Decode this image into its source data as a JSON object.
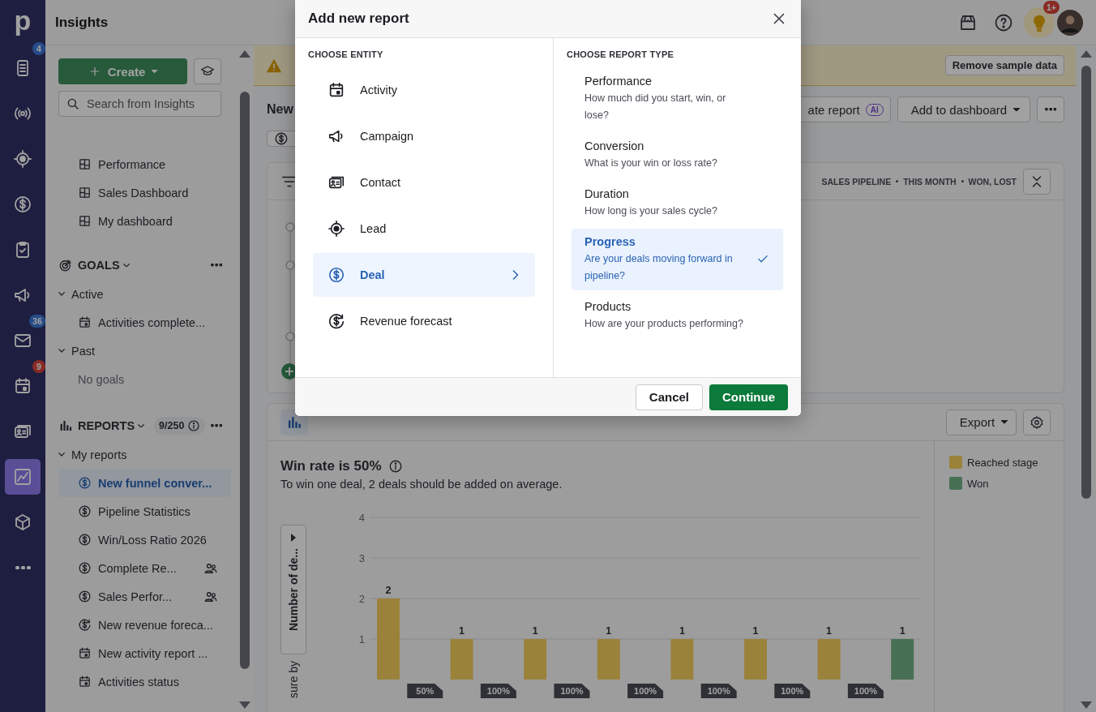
{
  "rail": {
    "logo": "p",
    "items": [
      {
        "selected": false,
        "badge": "4",
        "color": "#254c88"
      },
      {
        "selected": false
      },
      {
        "selected": false
      },
      {
        "selected": false
      },
      {
        "selected": false
      },
      {
        "selected": false
      },
      {
        "selected": false,
        "badge": "36",
        "color": "#254c88"
      },
      {
        "selected": false,
        "badge": "9",
        "color": "#882b25"
      },
      {
        "selected": false
      },
      {
        "selected": true
      },
      {
        "selected": false
      },
      {
        "selected": false
      }
    ]
  },
  "topbar": {
    "title": "Insights",
    "tips_badge": "1+"
  },
  "sidebar": {
    "create_button": "Create",
    "search": {
      "placeholder": "Search from Insights"
    },
    "dashboards": [
      {
        "label": "Performance"
      },
      {
        "label": "Sales Dashboard"
      },
      {
        "label": "My dashboard"
      }
    ],
    "goals": {
      "title": "GOALS",
      "expanded": true,
      "groups": [
        {
          "label": "Active",
          "expanded": true,
          "children": [
            {
              "label": "Activities complete...",
              "kind": "activity"
            }
          ]
        },
        {
          "label": "Past",
          "expanded": true,
          "empty_text": "No goals"
        }
      ]
    },
    "reports": {
      "title": "REPORTS",
      "expanded": true,
      "count": "9/250",
      "groups": [
        {
          "label": "My reports",
          "expanded": true,
          "children": [
            {
              "label": "New funnel conver...",
              "kind": "deal",
              "shared": false,
              "selected": true
            },
            {
              "label": "Pipeline Statistics",
              "kind": "deal",
              "shared": false,
              "selected": false
            },
            {
              "label": "Win/Loss Ratio 2026",
              "kind": "deal",
              "shared": false,
              "selected": false
            },
            {
              "label": "Complete Re...",
              "kind": "deal",
              "shared": true,
              "selected": false
            },
            {
              "label": "Sales Perfor...",
              "kind": "deal",
              "shared": true,
              "selected": false
            },
            {
              "label": "New revenue foreca...",
              "kind": "forecast",
              "shared": false,
              "selected": false
            },
            {
              "label": "New activity report ...",
              "kind": "activity",
              "shared": false,
              "selected": false
            },
            {
              "label": "Activities status",
              "kind": "activity",
              "shared": false,
              "selected": false
            }
          ]
        }
      ]
    }
  },
  "banner": {
    "button": "Remove sample data"
  },
  "report_header": {
    "title": "New",
    "ai_button": {
      "label": "ate report",
      "badge": "AI"
    },
    "dashboard_button": "Add to dashboard"
  },
  "filters_card": {
    "summary": [
      "SALES PIPELINE",
      "THIS MONTH",
      "WON, LOST"
    ]
  },
  "chart_card": {
    "export_button": "Export",
    "title": "Win rate is 50%",
    "subtitle": "To win one deal, 2 deals should be added on average.",
    "axis_selector": "Number of de...",
    "axis_caption": "sure by",
    "chart_data": {
      "type": "bar",
      "stacked": true,
      "grid": true,
      "ylim": [
        0,
        4
      ],
      "yticks": [
        1,
        2,
        3,
        4
      ],
      "data_labels": true,
      "series": [
        {
          "name": "Reached stage",
          "color": "#f6cf5e",
          "values": [
            2,
            1,
            1,
            1,
            1,
            1,
            1,
            null
          ]
        },
        {
          "name": "Won",
          "color": "#72b287",
          "values": [
            null,
            null,
            null,
            null,
            null,
            null,
            null,
            1
          ]
        }
      ],
      "annotations": [
        {
          "text": "50%"
        },
        {
          "text": "100%"
        },
        {
          "text": "100%"
        },
        {
          "text": "100%"
        },
        {
          "text": "100%"
        },
        {
          "text": "100%"
        },
        {
          "text": "100%"
        }
      ]
    }
  },
  "modal": {
    "title": "Add new report",
    "entity_heading": "CHOOSE ENTITY",
    "entities": [
      {
        "label": "Activity",
        "selected": false
      },
      {
        "label": "Campaign",
        "selected": false
      },
      {
        "label": "Contact",
        "selected": false
      },
      {
        "label": "Lead",
        "selected": false
      },
      {
        "label": "Deal",
        "selected": true
      },
      {
        "label": "Revenue forecast",
        "selected": false
      }
    ],
    "type_heading": "CHOOSE REPORT TYPE",
    "types": [
      {
        "title": "Performance",
        "description": "How much did you start, win, or lose?",
        "selected": false
      },
      {
        "title": "Conversion",
        "description": "What is your win or loss rate?",
        "selected": false
      },
      {
        "title": "Duration",
        "description": "How long is your sales cycle?",
        "selected": false
      },
      {
        "title": "Progress",
        "description": "Are your deals moving forward in pipeline?",
        "selected": true
      },
      {
        "title": "Products",
        "description": "How are your products performing?",
        "selected": false
      }
    ],
    "cancel_button": "Cancel",
    "continue_button": "Continue"
  }
}
